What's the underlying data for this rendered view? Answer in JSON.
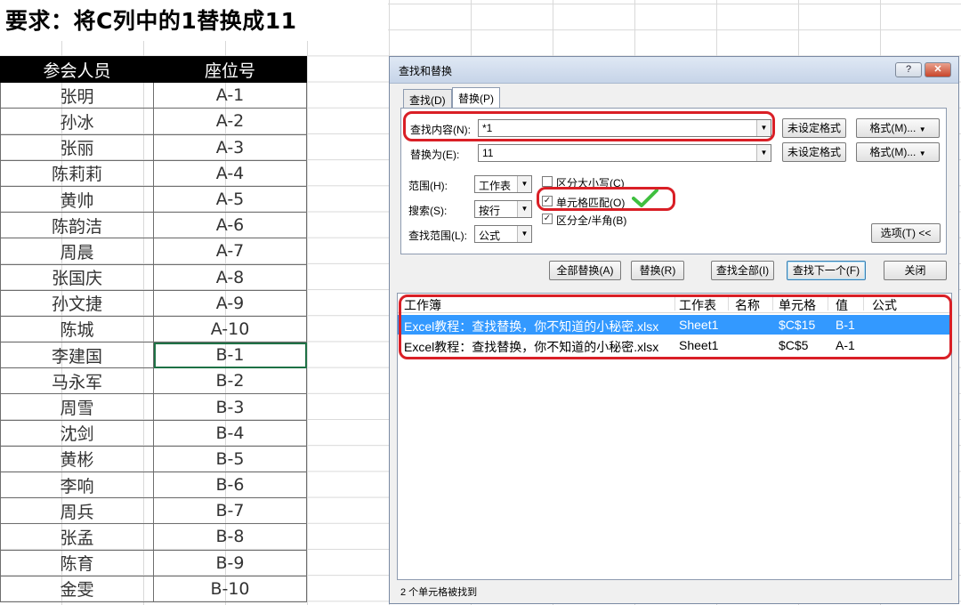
{
  "title": "要求：将C列中的1替换成11",
  "table": {
    "headers": [
      "参会人员",
      "座位号"
    ],
    "rows": [
      [
        "张明",
        "A-1"
      ],
      [
        "孙冰",
        "A-2"
      ],
      [
        "张丽",
        "A-3"
      ],
      [
        "陈莉莉",
        "A-4"
      ],
      [
        "黄帅",
        "A-5"
      ],
      [
        "陈韵洁",
        "A-6"
      ],
      [
        "周晨",
        "A-7"
      ],
      [
        "张国庆",
        "A-8"
      ],
      [
        "孙文捷",
        "A-9"
      ],
      [
        "陈城",
        "A-10"
      ],
      [
        "李建国",
        "B-1"
      ],
      [
        "马永军",
        "B-2"
      ],
      [
        "周雪",
        "B-3"
      ],
      [
        "沈剑",
        "B-4"
      ],
      [
        "黄彬",
        "B-5"
      ],
      [
        "李响",
        "B-6"
      ],
      [
        "周兵",
        "B-7"
      ],
      [
        "张孟",
        "B-8"
      ],
      [
        "陈育",
        "B-9"
      ],
      [
        "金雯",
        "B-10"
      ]
    ]
  },
  "dialog": {
    "title": "查找和替换",
    "help_label": "?",
    "close_label": "✕",
    "tabs": {
      "find": "查找(D)",
      "replace": "替换(P)"
    },
    "find_label": "查找内容(N):",
    "find_value": "*1",
    "replace_label": "替换为(E):",
    "replace_value": "11",
    "no_format_label": "未设定格式",
    "format_label": "格式(M)...",
    "scope_label": "范围(H):",
    "scope_value": "工作表",
    "search_label": "搜索(S):",
    "search_value": "按行",
    "lookin_label": "查找范围(L):",
    "lookin_value": "公式",
    "match_case_label": "区分大小写(C)",
    "match_case_checked": false,
    "match_cell_label": "单元格匹配(O)",
    "match_cell_checked": true,
    "match_width_label": "区分全/半角(B)",
    "match_width_checked": true,
    "options_label": "选项(T) <<",
    "buttons": {
      "replace_all": "全部替换(A)",
      "replace": "替换(R)",
      "find_all": "查找全部(I)",
      "find_next": "查找下一个(F)",
      "close": "关闭"
    },
    "results": {
      "columns": [
        "工作簿",
        "工作表",
        "名称",
        "单元格",
        "值",
        "公式"
      ],
      "rows": [
        {
          "workbook": "Excel教程：查找替换，你不知道的小秘密.xlsx",
          "sheet": "Sheet1",
          "name": "",
          "cell": "$C$15",
          "value": "B-1",
          "formula": ""
        },
        {
          "workbook": "Excel教程：查找替换，你不知道的小秘密.xlsx",
          "sheet": "Sheet1",
          "name": "",
          "cell": "$C$5",
          "value": "A-1",
          "formula": ""
        }
      ]
    },
    "status": "2 个单元格被找到"
  },
  "colors": {
    "highlight": "#d91f26",
    "selection": "#3399ff",
    "checkmark": "#3fbf3f",
    "header_bg": "#000000"
  }
}
